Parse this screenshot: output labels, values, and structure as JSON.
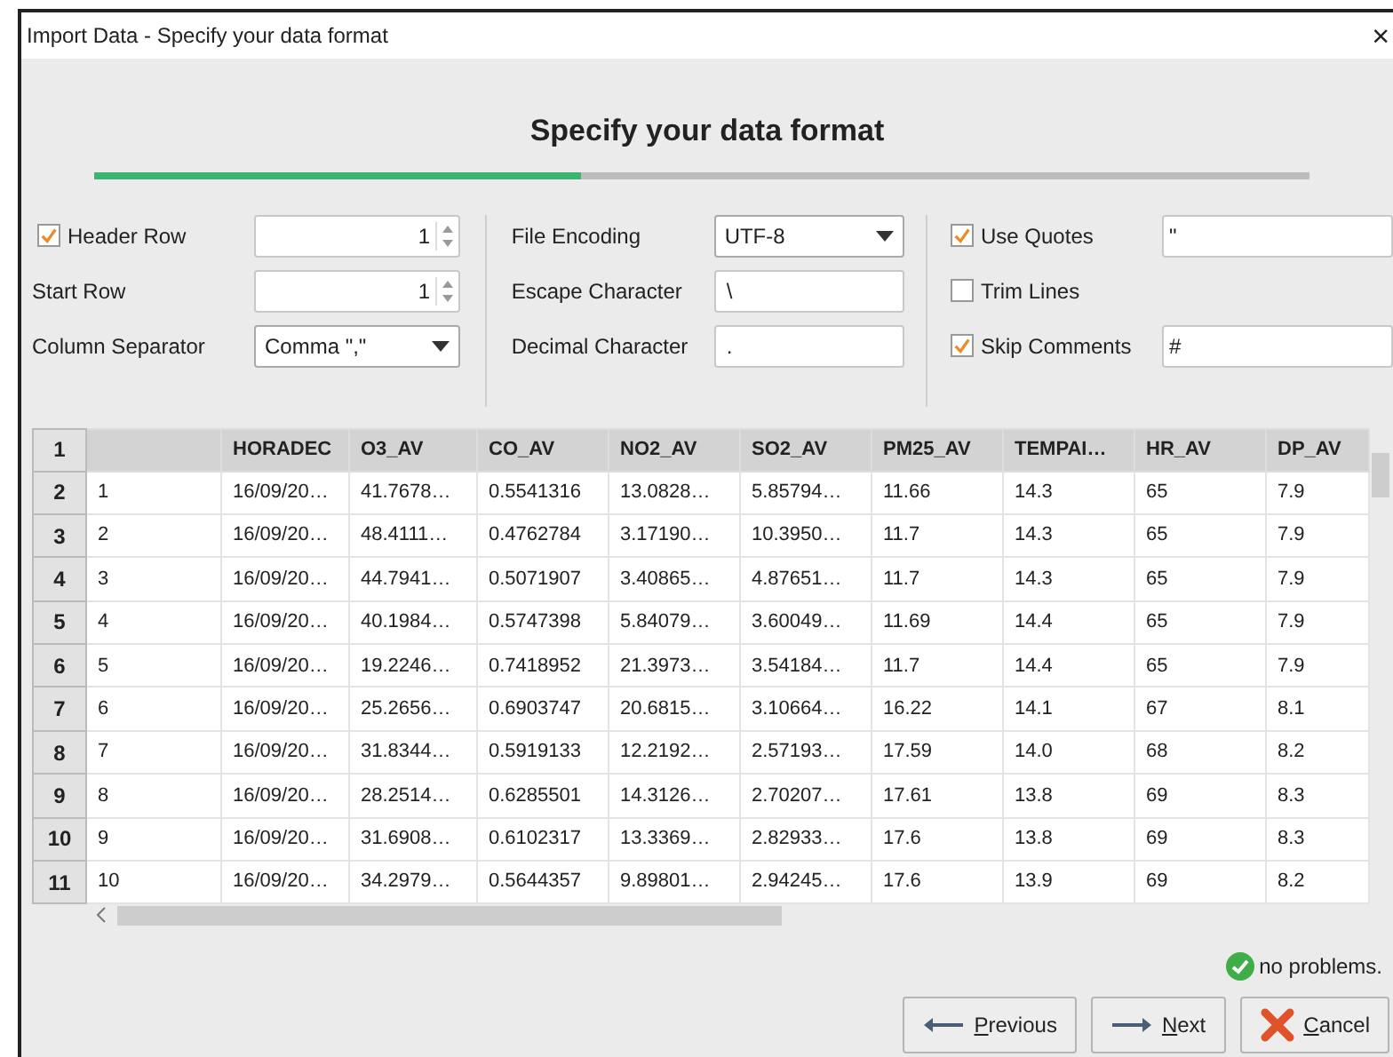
{
  "window": {
    "title": "Import Data - Specify your data format",
    "close": "×"
  },
  "heading": "Specify your data format",
  "progress": {
    "level": 0.4
  },
  "options_left": [
    {
      "kind": "spinner",
      "label": "Header Row",
      "checkbox": true,
      "checked": true,
      "value": "1"
    },
    {
      "kind": "spinner",
      "label": "Start Row",
      "checkbox": false,
      "value": "1"
    },
    {
      "kind": "dropdown",
      "label": "Column Separator",
      "checkbox": false,
      "value": "Comma \",\""
    }
  ],
  "options_middle": [
    {
      "kind": "dropdown",
      "label": "File Encoding",
      "value": "UTF-8"
    },
    {
      "kind": "text",
      "label": "Escape Character",
      "value": "\\"
    },
    {
      "kind": "text",
      "label": "Decimal Character",
      "value": "."
    }
  ],
  "options_right": [
    {
      "label": "Use Quotes",
      "checked": true,
      "value": "\""
    },
    {
      "label": "Trim Lines",
      "checked": false
    },
    {
      "label": "Skip Comments",
      "checked": true,
      "value": "#"
    }
  ],
  "table": {
    "corner": "1",
    "columns": [
      "",
      "HORADEC",
      "O3_AV",
      "CO_AV",
      "NO2_AV",
      "SO2_AV",
      "PM25_AV",
      "TEMPAI…",
      "HR_AV",
      "DP_AV"
    ],
    "rows": [
      {
        "number": "2",
        "cells": [
          "1",
          "16/09/20…",
          "41.7678…",
          "0.5541316",
          "13.0828…",
          "5.85794…",
          "11.66",
          "14.3",
          "65",
          "7.9"
        ]
      },
      {
        "number": "3",
        "cells": [
          "2",
          "16/09/20…",
          "48.4111…",
          "0.4762784",
          "3.17190…",
          "10.3950…",
          "11.7",
          "14.3",
          "65",
          "7.9"
        ]
      },
      {
        "number": "4",
        "cells": [
          "3",
          "16/09/20…",
          "44.7941…",
          "0.5071907",
          "3.40865…",
          "4.87651…",
          "11.7",
          "14.3",
          "65",
          "7.9"
        ]
      },
      {
        "number": "5",
        "cells": [
          "4",
          "16/09/20…",
          "40.1984…",
          "0.5747398",
          "5.84079…",
          "3.60049…",
          "11.69",
          "14.4",
          "65",
          "7.9"
        ]
      },
      {
        "number": "6",
        "cells": [
          "5",
          "16/09/20…",
          "19.2246…",
          "0.7418952",
          "21.3973…",
          "3.54184…",
          "11.7",
          "14.4",
          "65",
          "7.9"
        ]
      },
      {
        "number": "7",
        "cells": [
          "6",
          "16/09/20…",
          "25.2656…",
          "0.6903747",
          "20.6815…",
          "3.10664…",
          "16.22",
          "14.1",
          "67",
          "8.1"
        ]
      },
      {
        "number": "8",
        "cells": [
          "7",
          "16/09/20…",
          "31.8344…",
          "0.5919133",
          "12.2192…",
          "2.57193…",
          "17.59",
          "14.0",
          "68",
          "8.2"
        ]
      },
      {
        "number": "9",
        "cells": [
          "8",
          "16/09/20…",
          "28.2514…",
          "0.6285501",
          "14.3126…",
          "2.70207…",
          "17.61",
          "13.8",
          "69",
          "8.3"
        ]
      },
      {
        "number": "10",
        "cells": [
          "9",
          "16/09/20…",
          "31.6908…",
          "0.6102317",
          "13.3369…",
          "2.82933…",
          "17.6",
          "13.8",
          "69",
          "8.3"
        ]
      },
      {
        "number": "11",
        "cells": [
          "10",
          "16/09/20…",
          "34.2979…",
          "0.5644357",
          "9.89801…",
          "2.94245…",
          "17.6",
          "13.9",
          "69",
          "8.2"
        ]
      }
    ]
  },
  "status": {
    "kind": "ok",
    "text": "no problems."
  },
  "buttons": [
    {
      "kind": "previous",
      "label": "Previous"
    },
    {
      "kind": "next",
      "label": "Next"
    },
    {
      "kind": "cancel",
      "label": "Cancel"
    }
  ]
}
